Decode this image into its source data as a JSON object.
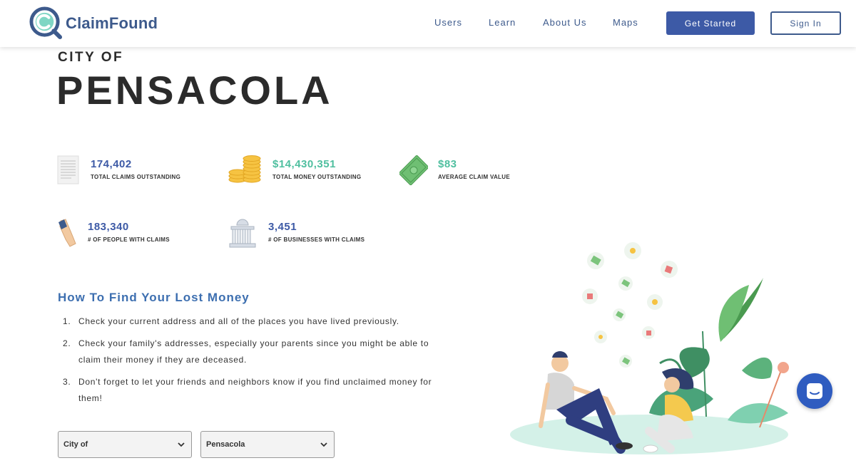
{
  "header": {
    "brand": "ClaimFound",
    "nav": [
      "Users",
      "Learn",
      "About Us",
      "Maps"
    ],
    "get_started": "Get Started",
    "sign_in": "Sign In"
  },
  "title": {
    "prefix": "CITY OF",
    "city": "PENSACOLA"
  },
  "stats": [
    {
      "value": "174,402",
      "label": "TOTAL CLAIMS OUTSTANDING",
      "icon": "document-icon"
    },
    {
      "value": "$14,430,351",
      "label": "TOTAL MONEY OUTSTANDING",
      "icon": "coins-icon"
    },
    {
      "value": "$83",
      "label": "AVERAGE CLAIM VALUE",
      "icon": "cash-icon"
    },
    {
      "value": "183,340",
      "label": "# OF PEOPLE WITH CLAIMS",
      "icon": "hand-icon"
    },
    {
      "value": "3,451",
      "label": "# OF BUSINESSES WITH CLAIMS",
      "icon": "building-icon"
    }
  ],
  "colors": {
    "brand_blue": "#3d5aa6",
    "accent_green": "#4fbf9f",
    "heading_blue": "#3d6fb0"
  },
  "howto": {
    "title": "How To Find Your Lost Money",
    "steps": [
      {
        "num": "1.",
        "text": "Check your current address and all of the places you have lived previously."
      },
      {
        "num": "2.",
        "text": "Check your family's addresses, especially your parents since you might be able to claim their money if they are deceased."
      },
      {
        "num": "3.",
        "text": "Don't forget to let your friends and neighbors know if you find unclaimed money for them!"
      }
    ]
  },
  "filters": {
    "type_selected": "City of",
    "place_selected": "Pensacola"
  },
  "chat": {
    "icon": "chat-icon"
  }
}
